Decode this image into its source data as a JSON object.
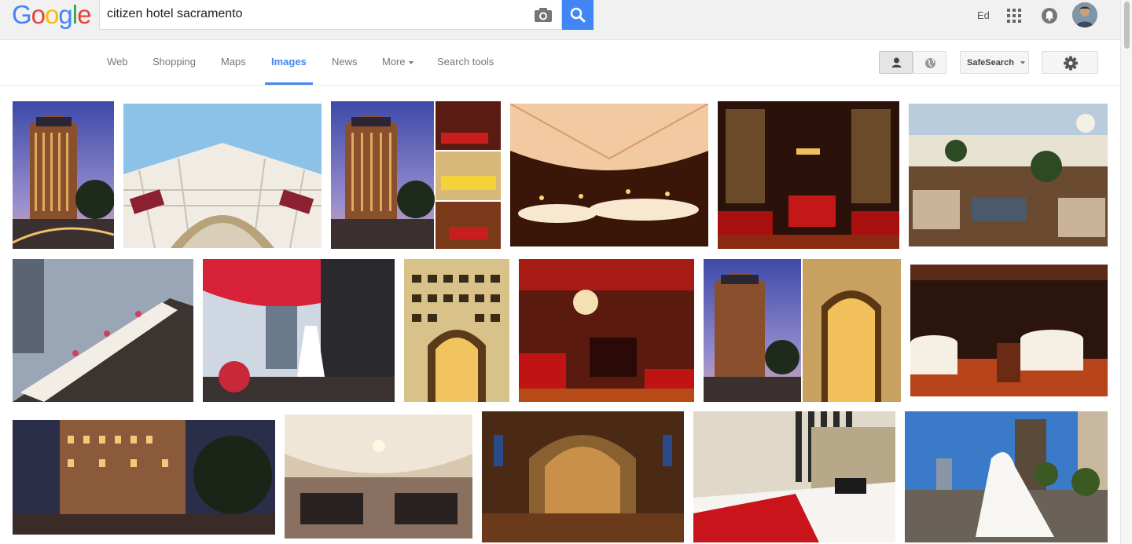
{
  "logo": {
    "letters": [
      "G",
      "o",
      "o",
      "g",
      "l",
      "e"
    ],
    "colors": [
      "#4285f4",
      "#ea4335",
      "#fbbc05",
      "#4285f4",
      "#34a853",
      "#ea4335"
    ]
  },
  "search": {
    "query": "citizen hotel sacramento"
  },
  "account": {
    "name": "Ed"
  },
  "tabs": [
    {
      "label": "Web"
    },
    {
      "label": "Shopping"
    },
    {
      "label": "Maps"
    },
    {
      "label": "Images"
    },
    {
      "label": "News"
    },
    {
      "label": "More"
    },
    {
      "label": "Search tools"
    }
  ],
  "active_tab": "Images",
  "tools": {
    "safesearch_label": "SafeSearch"
  },
  "colors": {
    "accent": "#4285f4",
    "header_bg": "#f1f1f1"
  },
  "results": [
    {
      "id": "r1",
      "theme": "tower-dusk"
    },
    {
      "id": "r2",
      "theme": "facade-up"
    },
    {
      "id": "r3",
      "theme": "collage"
    },
    {
      "id": "r4",
      "theme": "ballroom-gold"
    },
    {
      "id": "r5",
      "theme": "red-lounge"
    },
    {
      "id": "r6",
      "theme": "terrace-day"
    },
    {
      "id": "r7",
      "theme": "rooftop-table"
    },
    {
      "id": "r8",
      "theme": "red-umbrella"
    },
    {
      "id": "r9",
      "theme": "facade-gold"
    },
    {
      "id": "r10",
      "theme": "red-bar"
    },
    {
      "id": "r11",
      "theme": "tower-door"
    },
    {
      "id": "r12",
      "theme": "restaurant"
    },
    {
      "id": "r13",
      "theme": "street-night"
    },
    {
      "id": "r14",
      "theme": "ceremony-hall"
    },
    {
      "id": "r15",
      "theme": "cathedral"
    },
    {
      "id": "r16",
      "theme": "bedroom"
    },
    {
      "id": "r17",
      "theme": "bride-rooftop"
    }
  ]
}
